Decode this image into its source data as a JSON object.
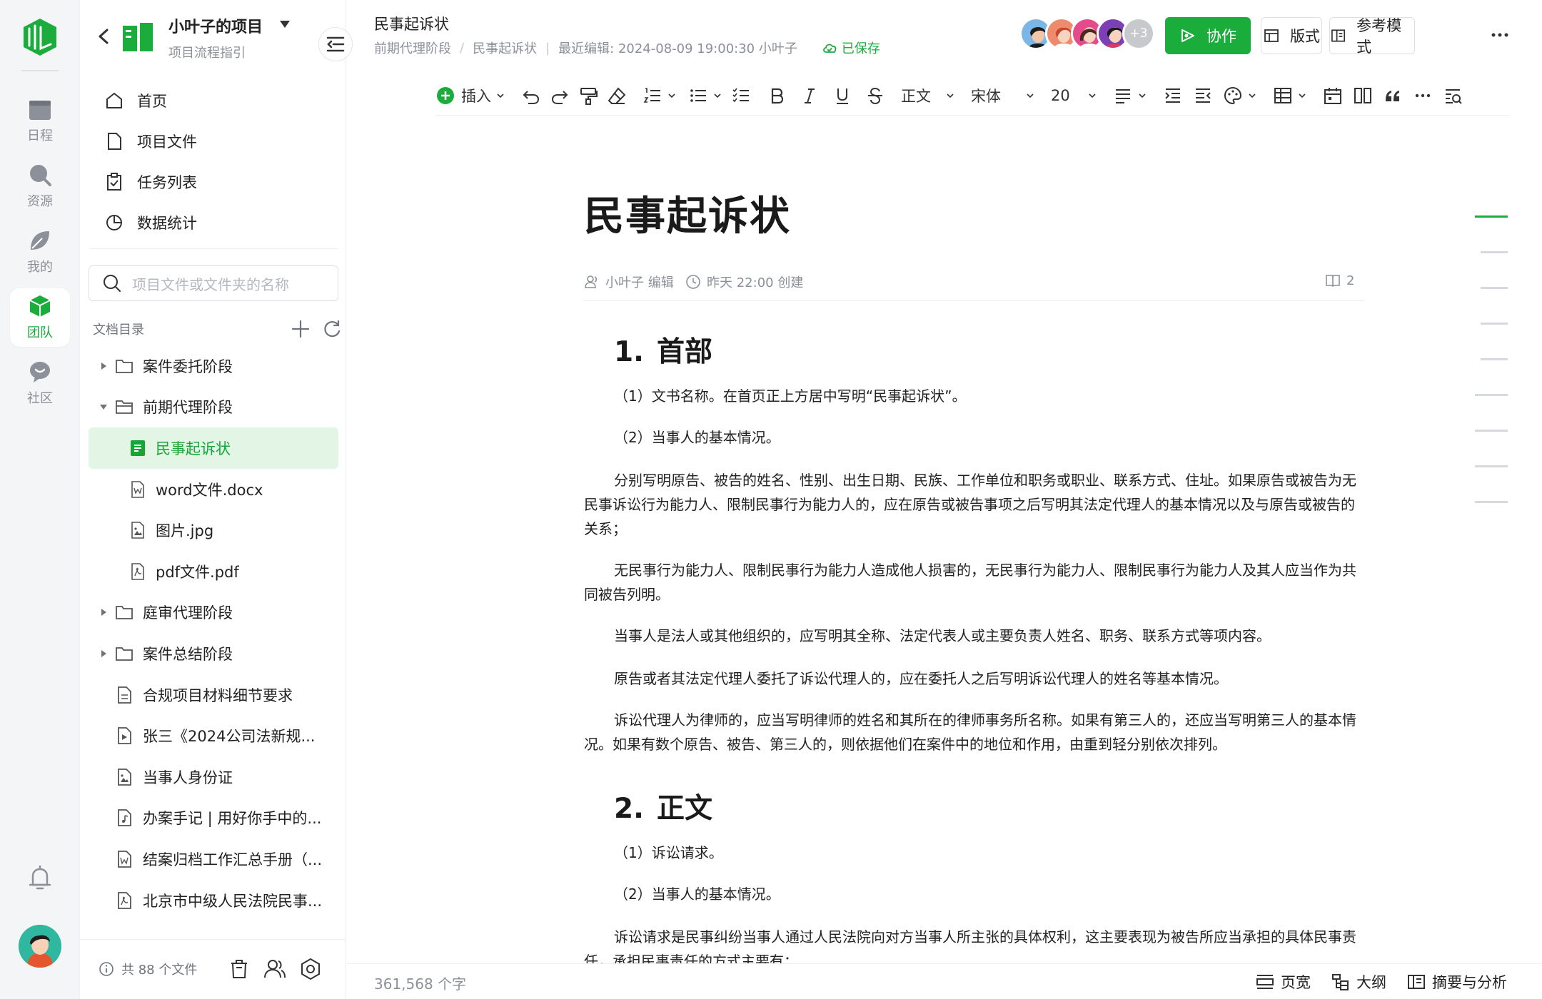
{
  "rail": {
    "items": [
      {
        "label": "日程",
        "icon": "calendar-icon"
      },
      {
        "label": "资源",
        "icon": "search-icon"
      },
      {
        "label": "我的",
        "icon": "leaf-icon"
      },
      {
        "label": "团队",
        "icon": "cube-icon",
        "active": true
      },
      {
        "label": "社区",
        "icon": "chat-icon"
      }
    ]
  },
  "project": {
    "name": "小叶子的项目",
    "subtitle": "项目流程指引"
  },
  "nav": {
    "items": [
      {
        "label": "首页",
        "icon": "home-icon"
      },
      {
        "label": "项目文件",
        "icon": "file-icon"
      },
      {
        "label": "任务列表",
        "icon": "clipboard-icon"
      },
      {
        "label": "数据统计",
        "icon": "pie-chart-icon"
      }
    ]
  },
  "search": {
    "placeholder": "项目文件或文件夹的名称"
  },
  "directory": {
    "title": "文档目录",
    "items": [
      {
        "label": "案件委托阶段",
        "type": "folder",
        "expanded": false
      },
      {
        "label": "前期代理阶段",
        "type": "folder",
        "expanded": true
      },
      {
        "label": "民事起诉状",
        "type": "doc",
        "selected": true
      },
      {
        "label": "word文件.docx",
        "type": "word"
      },
      {
        "label": "图片.jpg",
        "type": "image"
      },
      {
        "label": "pdf文件.pdf",
        "type": "pdf"
      },
      {
        "label": "庭审代理阶段",
        "type": "folder",
        "expanded": false
      },
      {
        "label": "案件总结阶段",
        "type": "folder",
        "expanded": false
      },
      {
        "label": "合规项目材料细节要求",
        "type": "doc"
      },
      {
        "label": "张三《2024公司法新规...",
        "type": "video"
      },
      {
        "label": "当事人身份证",
        "type": "image"
      },
      {
        "label": "办案手记 | 用好你手中的...",
        "type": "audio"
      },
      {
        "label": "结案归档工作汇总手册（...",
        "type": "word"
      },
      {
        "label": "北京市中级人民法院民事...",
        "type": "pdf"
      }
    ]
  },
  "sidebar_footer": {
    "file_count": "共 88 个文件"
  },
  "header": {
    "doc_title": "民事起诉状",
    "breadcrumb": [
      "前期代理阶段",
      "民事起诉状"
    ],
    "last_edit": "最近编辑: 2024-08-09 19:00:30 小叶子",
    "saved": "已保存",
    "more_collaborators": "+3",
    "collab_label": "协作",
    "layout_label": "版式",
    "reference_label": "参考模式"
  },
  "toolbar": {
    "insert_label": "插入",
    "paragraph_style": "正文",
    "font_name": "宋体",
    "font_size": "20"
  },
  "document": {
    "title": "民事起诉状",
    "author": "小叶子 编辑",
    "created": "昨天 22:00 创建",
    "read_count": "2",
    "sections": [
      {
        "num": "1.",
        "heading": "首部",
        "paragraphs": [
          "（1）文书名称。在首页正上方居中写明“民事起诉状”。",
          "（2）当事人的基本情况。",
          "分别写明原告、被告的姓名、性别、出生日期、民族、工作单位和职务或职业、联系方式、住址。如果原告或被告为无民事诉讼行为能力人、限制民事行为能力人的，应在原告或被告事项之后写明其法定代理人的基本情况以及与原告或被告的关系；",
          "无民事行为能力人、限制民事行为能力人造成他人损害的，无民事行为能力人、限制民事行为能力人及其人应当作为共同被告列明。",
          "当事人是法人或其他组织的，应写明其全称、法定代表人或主要负责人姓名、职务、联系方式等项内容。",
          "原告或者其法定代理人委托了诉讼代理人的，应在委托人之后写明诉讼代理人的姓名等基本情况。",
          "诉讼代理人为律师的，应当写明律师的姓名和其所在的律师事务所名称。如果有第三人的，还应当写明第三人的基本情况。如果有数个原告、被告、第三人的，则依据他们在案件中的地位和作用，由重到轻分别依次排列。"
        ]
      },
      {
        "num": "2.",
        "heading": "正文",
        "paragraphs": [
          "（1）诉讼请求。",
          "（2）当事人的基本情况。",
          "诉讼请求是民事纠纷当事人通过人民法院向对方当事人所主张的具体权利，这主要表现为被告所应当承担的具体民事责任，承担民事责任的方式主要有："
        ]
      }
    ]
  },
  "status": {
    "word_count": "361,568 个字",
    "page_width": "页宽",
    "outline": "大纲",
    "summary": "摘要与分析"
  },
  "colors": {
    "accent": "#1aad3b",
    "selected_bg": "#e3f6e6"
  }
}
